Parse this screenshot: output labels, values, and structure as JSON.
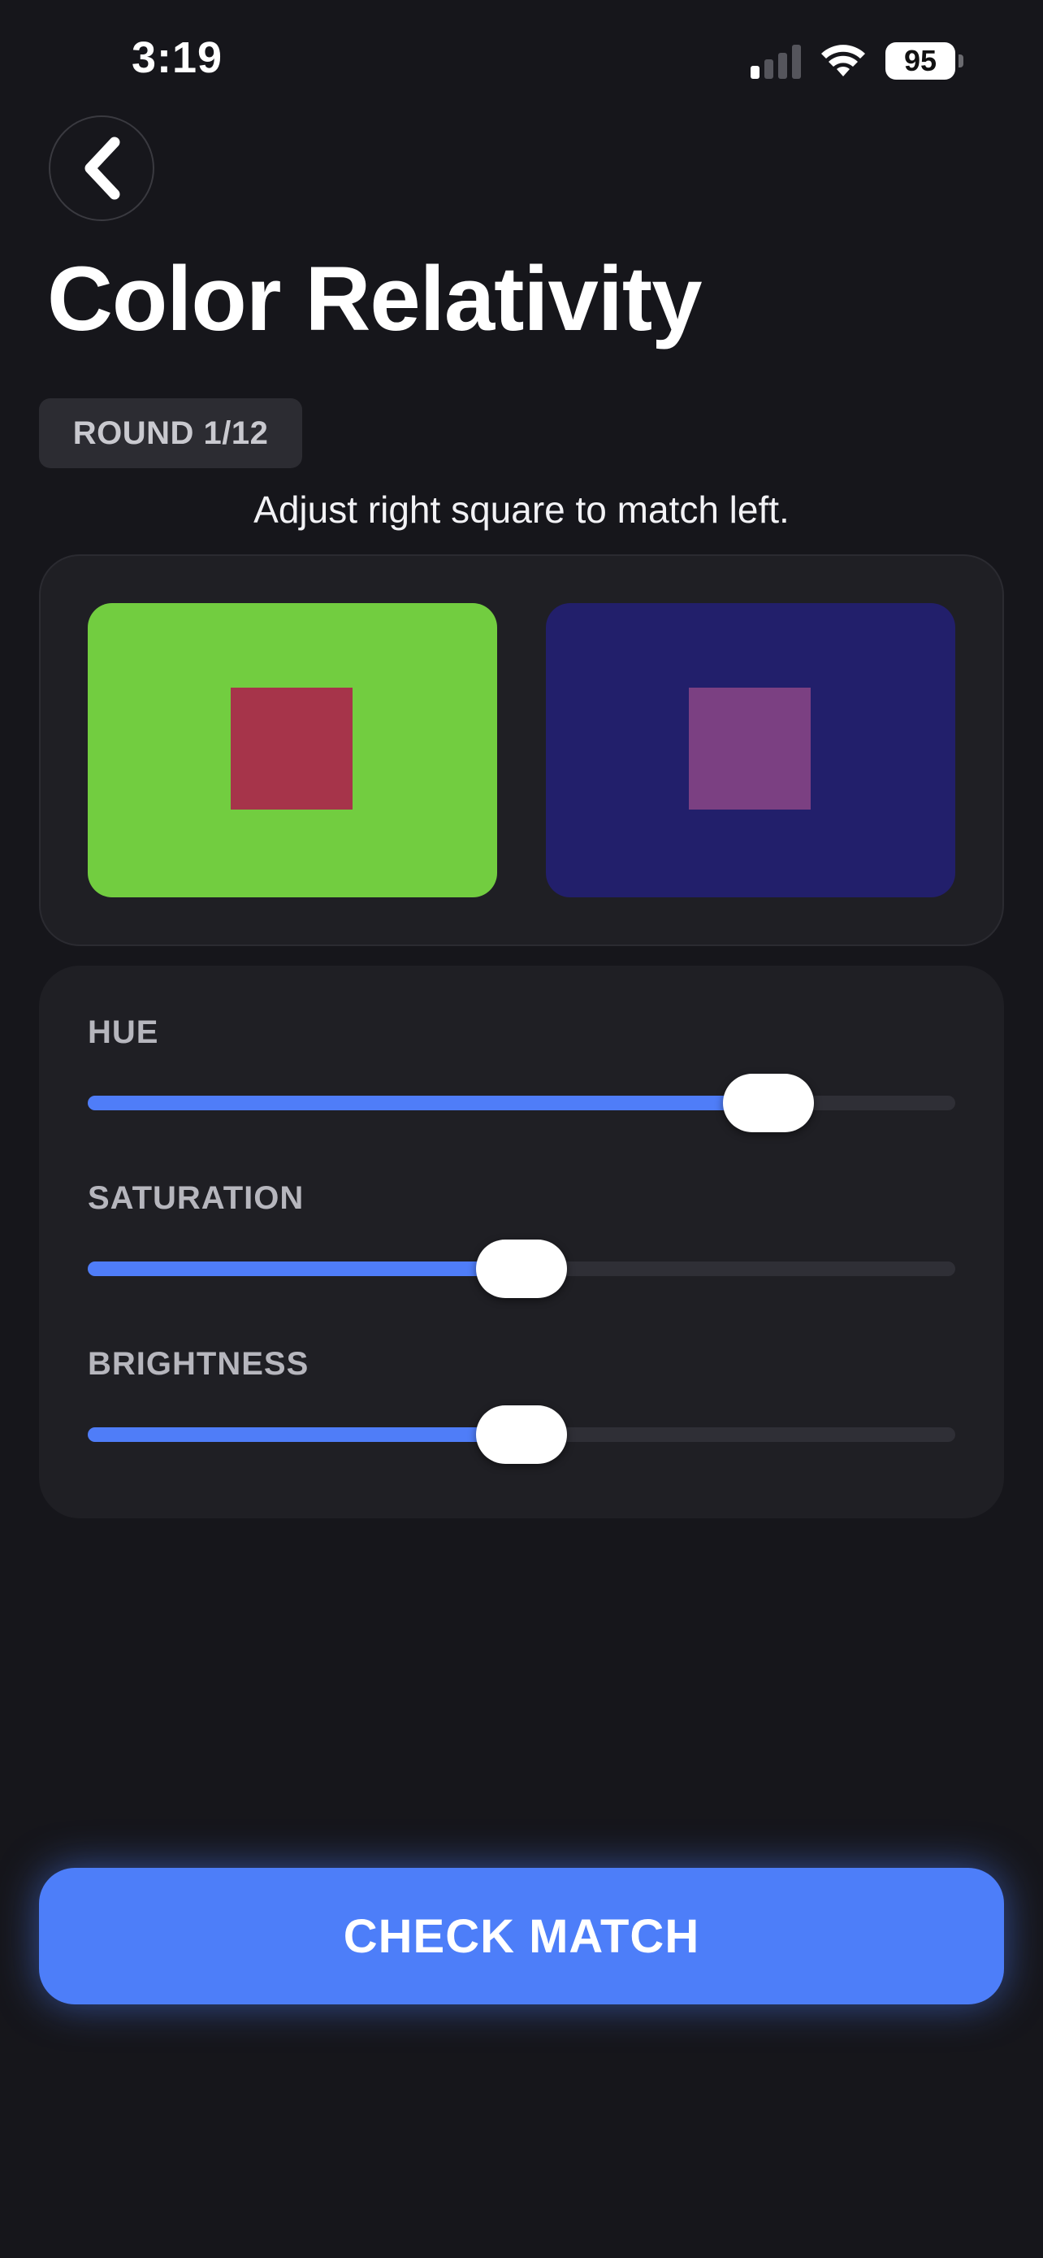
{
  "status_bar": {
    "time": "3:19",
    "battery_percent": "95",
    "signal_bars_active": 1,
    "signal_bars_total": 4,
    "icons": [
      "signal-icon",
      "wifi-icon",
      "battery-icon"
    ]
  },
  "header": {
    "back_icon": "chevron-left-icon",
    "title": "Color Relativity"
  },
  "round": {
    "label": "ROUND 1/12"
  },
  "instruction": "Adjust right square to match left.",
  "comparison": {
    "left": {
      "background": "#72cd40",
      "square": "#a6344a"
    },
    "right": {
      "background": "#221f6b",
      "square": "#7b4082"
    }
  },
  "sliders": [
    {
      "label": "HUE",
      "value": 0.785
    },
    {
      "label": "SATURATION",
      "value": 0.5
    },
    {
      "label": "BRIGHTNESS",
      "value": 0.5
    }
  ],
  "actions": {
    "check_label": "CHECK MATCH"
  },
  "colors": {
    "background": "#16161b",
    "card": "#1f1f24",
    "accent": "#4d7ef9",
    "track": "#2f2f36"
  }
}
